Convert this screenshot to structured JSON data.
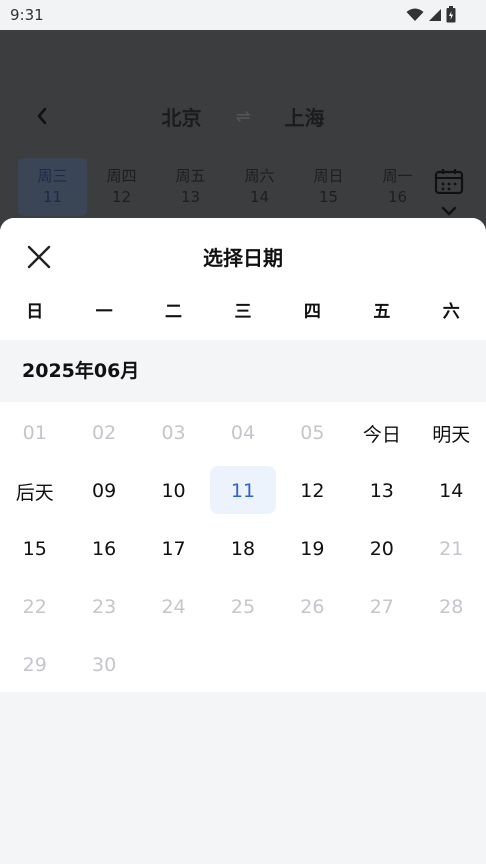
{
  "status_bar": {
    "time": "9:31"
  },
  "background": {
    "from_city": "北京",
    "to_city": "上海",
    "swap_symbol": "⇌",
    "dates": [
      {
        "weekday": "周三",
        "day": "11",
        "active": true
      },
      {
        "weekday": "周四",
        "day": "12"
      },
      {
        "weekday": "周五",
        "day": "13"
      },
      {
        "weekday": "周六",
        "day": "14"
      },
      {
        "weekday": "周日",
        "day": "15"
      },
      {
        "weekday": "周一",
        "day": "16"
      }
    ]
  },
  "sheet": {
    "title": "选择日期",
    "weekdays": [
      "日",
      "一",
      "二",
      "三",
      "四",
      "五",
      "六"
    ],
    "month": "2025年06月",
    "rows": [
      [
        {
          "label": "01",
          "disabled": true
        },
        {
          "label": "02",
          "disabled": true
        },
        {
          "label": "03",
          "disabled": true
        },
        {
          "label": "04",
          "disabled": true
        },
        {
          "label": "05",
          "disabled": true
        },
        {
          "label": "今日"
        },
        {
          "label": "明天"
        }
      ],
      [
        {
          "label": "后天"
        },
        {
          "label": "09"
        },
        {
          "label": "10"
        },
        {
          "label": "11",
          "selected": true
        },
        {
          "label": "12"
        },
        {
          "label": "13"
        },
        {
          "label": "14"
        }
      ],
      [
        {
          "label": "15"
        },
        {
          "label": "16"
        },
        {
          "label": "17"
        },
        {
          "label": "18"
        },
        {
          "label": "19"
        },
        {
          "label": "20"
        },
        {
          "label": "21",
          "disabled": true
        }
      ],
      [
        {
          "label": "22",
          "disabled": true
        },
        {
          "label": "23",
          "disabled": true
        },
        {
          "label": "24",
          "disabled": true
        },
        {
          "label": "25",
          "disabled": true
        },
        {
          "label": "26",
          "disabled": true
        },
        {
          "label": "27",
          "disabled": true
        },
        {
          "label": "28",
          "disabled": true
        }
      ],
      [
        {
          "label": "29",
          "disabled": true
        },
        {
          "label": "30",
          "disabled": true
        }
      ]
    ]
  },
  "colors": {
    "selected_bg": "#edf3fd",
    "selected_text": "#2f63c8",
    "disabled_text": "#c4c6cb"
  }
}
